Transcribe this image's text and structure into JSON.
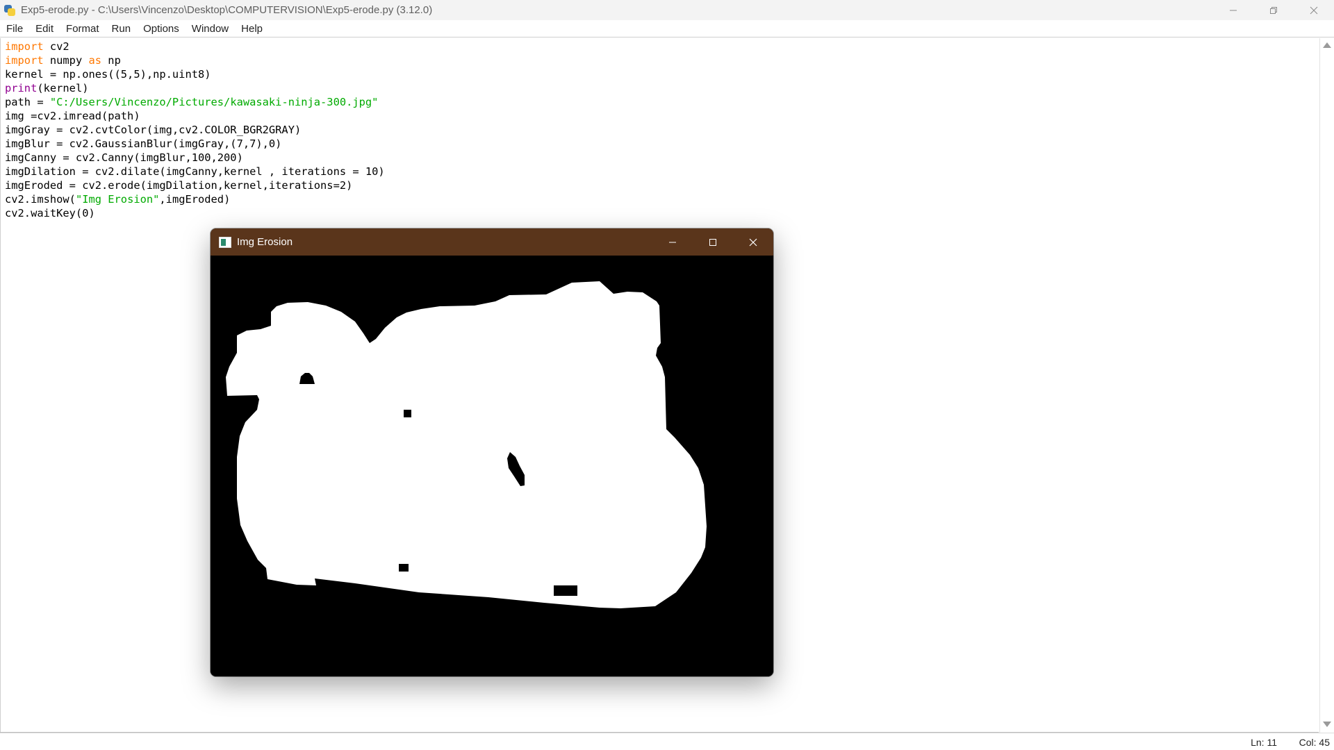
{
  "window": {
    "title": "Exp5-erode.py - C:\\Users\\Vincenzo\\Desktop\\COMPUTERVISION\\Exp5-erode.py (3.12.0)"
  },
  "menu": [
    "File",
    "Edit",
    "Format",
    "Run",
    "Options",
    "Window",
    "Help"
  ],
  "code_lines": [
    [
      {
        "t": "import",
        "c": "kw"
      },
      {
        "t": " cv2"
      }
    ],
    [
      {
        "t": "import",
        "c": "kw"
      },
      {
        "t": " numpy "
      },
      {
        "t": "as",
        "c": "kw"
      },
      {
        "t": " np"
      }
    ],
    [
      {
        "t": "kernel = np.ones((5,5),np.uint8)"
      }
    ],
    [
      {
        "t": "print",
        "c": "bi"
      },
      {
        "t": "(kernel)"
      }
    ],
    [
      {
        "t": "path = "
      },
      {
        "t": "\"C:/Users/Vincenzo/Pictures/kawasaki-ninja-300.jpg\"",
        "c": "str"
      }
    ],
    [
      {
        "t": "img =cv2.imread(path)"
      }
    ],
    [
      {
        "t": "imgGray = cv2.cvtColor(img,cv2.COLOR_BGR2GRAY)"
      }
    ],
    [
      {
        "t": "imgBlur = cv2.GaussianBlur(imgGray,(7,7),0)"
      }
    ],
    [
      {
        "t": "imgCanny = cv2.Canny(imgBlur,100,200)"
      }
    ],
    [
      {
        "t": "imgDilation = cv2.dilate(imgCanny,kernel , iterations = 10)"
      }
    ],
    [
      {
        "t": "imgEroded = cv2.erode(imgDilation,kernel,iterations=2)"
      }
    ],
    [
      {
        "t": "cv2.imshow("
      },
      {
        "t": "\"Img Erosion\"",
        "c": "str"
      },
      {
        "t": ",imgEroded)"
      }
    ],
    [
      {
        "t": "cv2.waitKey(0)"
      }
    ]
  ],
  "status": {
    "ln": "Ln: 11",
    "col": "Col: 45"
  },
  "image_window": {
    "title": "Img Erosion"
  },
  "colors": {
    "keyword": "#ff7700",
    "builtin": "#900090",
    "string": "#00aa00",
    "image_titlebar": "#5a351b"
  }
}
